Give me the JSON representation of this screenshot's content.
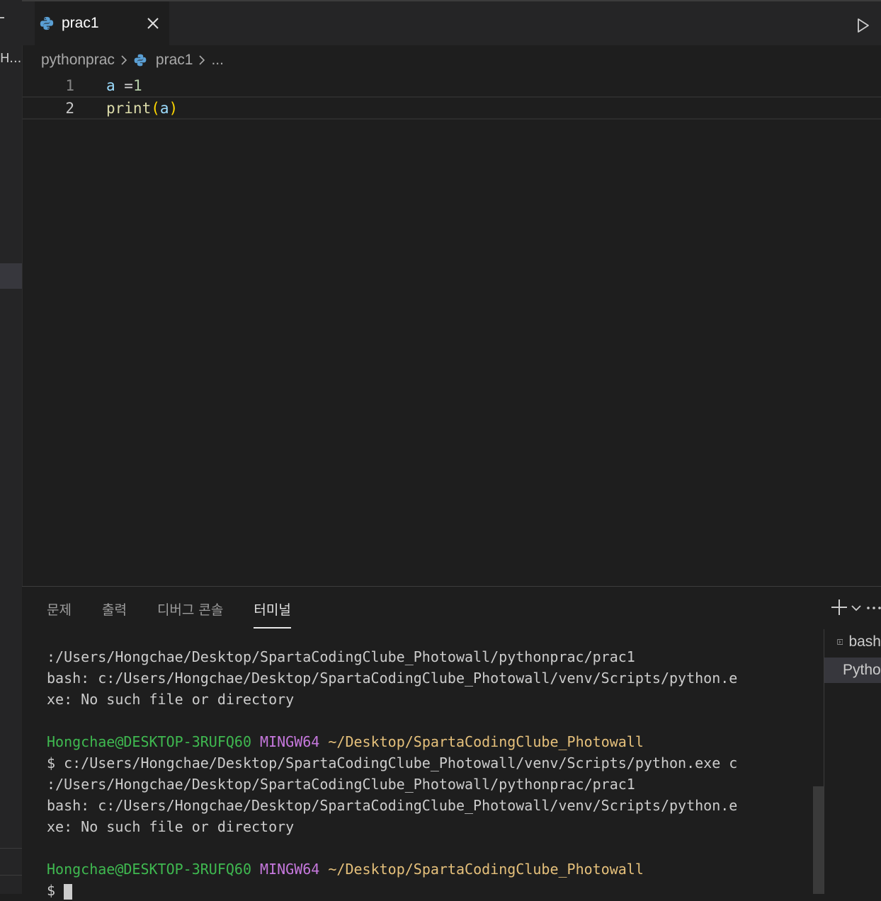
{
  "sidebar": {
    "truncated_label": "H..."
  },
  "tab": {
    "label": "prac1"
  },
  "breadcrumb": {
    "folder": "pythonprac",
    "file": "prac1",
    "more": "..."
  },
  "editor": {
    "lines": [
      {
        "number": "1",
        "tokens": {
          "var": "a",
          "op": " =",
          "num": "1"
        }
      },
      {
        "number": "2",
        "tokens": {
          "fn": "print",
          "open": "(",
          "arg": "a",
          "close": ")"
        }
      }
    ]
  },
  "panel": {
    "tabs": [
      "문제",
      "출력",
      "디버그 콘솔",
      "터미널"
    ],
    "active_tab": "터미널"
  },
  "terminal": {
    "lines": [
      ":/Users/Hongchae/Desktop/SpartaCodingClube_Photowall/pythonprac/prac1",
      "bash: c:/Users/Hongchae/Desktop/SpartaCodingClube_Photowall/venv/Scripts/python.e",
      "xe: No such file or directory",
      "",
      "Hongchae@DESKTOP-3RUFQ60",
      "MINGW64",
      "~/Desktop/SpartaCodingClube_Photowall",
      "$ c:/Users/Hongchae/Desktop/SpartaCodingClube_Photowall/venv/Scripts/python.exe c",
      ":/Users/Hongchae/Desktop/SpartaCodingClube_Photowall/pythonprac/prac1",
      "bash: c:/Users/Hongchae/Desktop/SpartaCodingClube_Photowall/venv/Scripts/python.e",
      "xe: No such file or directory",
      "",
      "Hongchae@DESKTOP-3RUFQ60",
      "MINGW64",
      "~/Desktop/SpartaCodingClube_Photowall",
      "$ "
    ]
  },
  "terminal_list": {
    "items": [
      "bash",
      "Python"
    ]
  },
  "colors": {
    "user": "#3fb950",
    "mingw": "#c678dd",
    "path": "#e5c07b"
  }
}
